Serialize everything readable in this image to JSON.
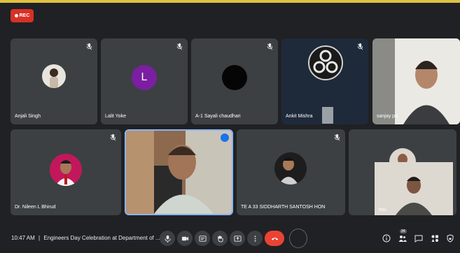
{
  "recording": {
    "label": "REC"
  },
  "participants": [
    {
      "name": "Anjali Singh"
    },
    {
      "name": "Lalit Yoke",
      "initial": "L"
    },
    {
      "name": "A-1 Sayali chaudhari"
    },
    {
      "name": "Ankit Mishra"
    },
    {
      "name": "sanjay pa"
    },
    {
      "name": "Dr. Nileen L Bhirud"
    },
    {
      "name": ""
    },
    {
      "name": "TE A 33 SIDDHARTH SANTOSH HON"
    },
    {
      "name": "You"
    }
  ],
  "bottom_bar": {
    "time": "10:47 AM",
    "separator": "|",
    "meeting_title": "Engineers Day Celebration at Department of ...",
    "people_count": "34"
  },
  "colors": {
    "tile_bg": "#3c4043",
    "page_bg": "#202124",
    "end_call": "#ea4335",
    "rec": "#d93025",
    "accent_top": "#e0c341",
    "active_speaker": "#8ab4f8"
  }
}
